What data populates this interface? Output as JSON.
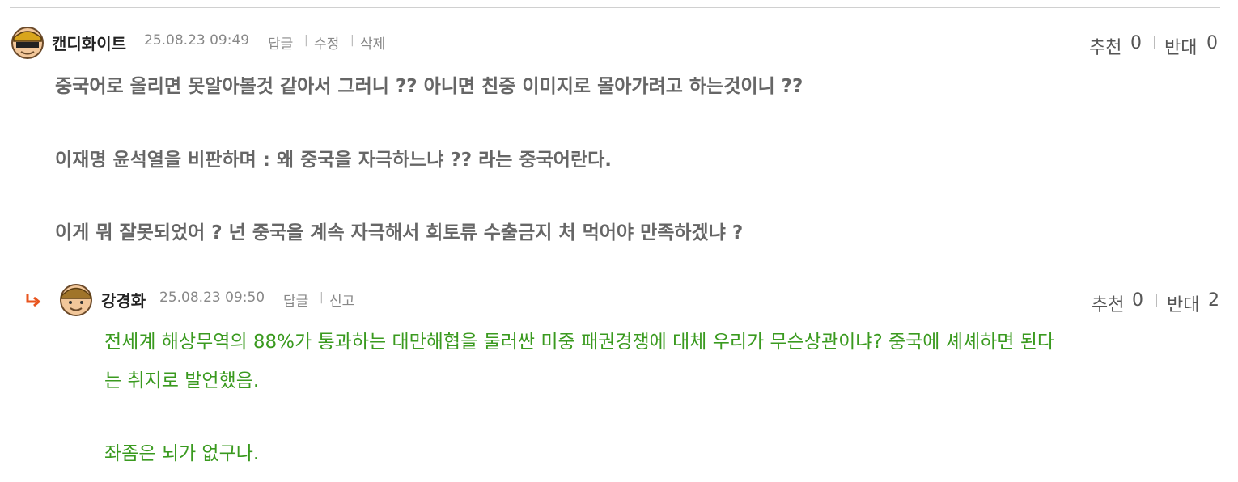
{
  "comment": {
    "author": "캔디화이트",
    "date": "25.08.23 09:49",
    "actions": [
      "답글",
      "수정",
      "삭제"
    ],
    "recommend_label": "추천",
    "recommend_count": "0",
    "oppose_label": "반대",
    "oppose_count": "0",
    "lines": [
      "중국어로 올리면 못알아볼것 같아서 그러니 ?? 아니면 친중 이미지로 몰아가려고 하는것이니 ??",
      "이재명 윤석열을 비판하며 : 왜 중국을 자극하느냐 ?? 라는 중국어란다.",
      "이게 뭐 잘못되었어 ? 넌 중국을 계속 자극해서 희토류 수출금지 처 먹어야 만족하겠냐 ?"
    ]
  },
  "reply": {
    "author": "강경화",
    "date": "25.08.23 09:50",
    "actions": [
      "답글",
      "신고"
    ],
    "recommend_label": "추천",
    "recommend_count": "0",
    "oppose_label": "반대",
    "oppose_count": "2",
    "lines": [
      "전세계 해상무역의 88%가 통과하는 대만해협을 둘러싼 미중 패권경쟁에 대체 우리가 무슨상관이냐? 중국에 셰셰하면 된다",
      "는 취지로 발언했음.",
      "좌좀은 뇌가 없구나."
    ]
  },
  "icons": {
    "reply_arrow": "reply-arrow-icon",
    "avatar_1": "avatar-icon",
    "avatar_2": "avatar-icon"
  },
  "colors": {
    "reply_text": "#3a9a1f",
    "reply_arrow": "#e8541e",
    "divider": "#d0d0d0"
  }
}
